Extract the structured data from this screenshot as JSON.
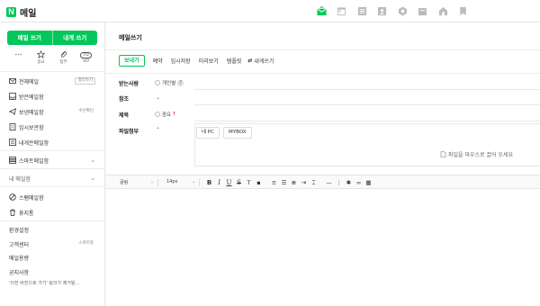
{
  "app": {
    "logo_letter": "N",
    "title": "메일",
    "brand_color": "#03c75a"
  },
  "top_icons": [
    "mail-icon",
    "calendar-icon",
    "list-icon",
    "contacts-icon",
    "settings-gear-icon",
    "box-icon",
    "home-icon",
    "bookmark-icon"
  ],
  "sidebar": {
    "write_label": "메일 쓰기",
    "self_label": "내게 쓰기",
    "quick": [
      {
        "icon": "dots-icon",
        "label": ""
      },
      {
        "icon": "star-icon",
        "label": "중요"
      },
      {
        "icon": "paperclip-icon",
        "label": "첨부"
      },
      {
        "icon": "badge-icon",
        "label": "VIP",
        "badge": "TO"
      }
    ],
    "folders": [
      {
        "label": "전체메일",
        "action": "정리하기"
      },
      {
        "label": "받은메일함"
      },
      {
        "label": "보낸메일함",
        "action": "수신확인"
      },
      {
        "label": "임시보관함"
      },
      {
        "label": "내게쓴메일함"
      }
    ],
    "smart": "스마트메일함",
    "my": "내 메일함",
    "spam": "스팸메일함",
    "trash": "휴지통",
    "settings": "환경설정",
    "support": "고객센터",
    "support_badge": "스마트봇",
    "usage": "메일용량",
    "notice": "공지사항",
    "notice_text": "'이전 버전으로 가기' 링크가 제거될..."
  },
  "compose": {
    "title": "메일쓰기",
    "toolbar": {
      "send": "보내기",
      "reserve": "예약",
      "draft": "임시저장",
      "preview": "미리보기",
      "template": "템플릿",
      "to_self": "내게쓰기"
    },
    "to": {
      "label": "받는사람",
      "option": "개인별",
      "help": "?"
    },
    "cc": {
      "label": "참조"
    },
    "subject": {
      "label": "제목",
      "option": "중요",
      "mark": "!"
    },
    "attach": {
      "label": "파일첨부",
      "my_pc": "내 PC",
      "mybox": "MYBOX",
      "hint": "파일을 마우스로 끌어 오세요"
    },
    "editor": {
      "font": "굴림",
      "size": "14px"
    }
  }
}
